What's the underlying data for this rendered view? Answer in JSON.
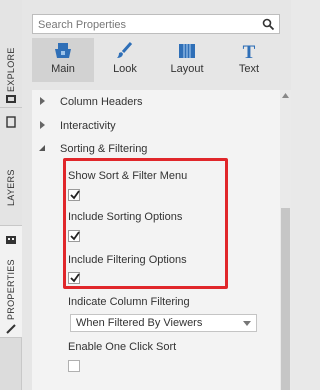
{
  "rail": {
    "tabs": [
      {
        "label": "EXPLORE",
        "icon": "explore-icon"
      },
      {
        "label": "LAYERS",
        "icon": "layers-icon"
      },
      {
        "label": "PROPERTIES",
        "icon": "properties-icon"
      }
    ]
  },
  "search": {
    "placeholder": "Search Properties",
    "icon": "search-icon"
  },
  "toptabs": [
    {
      "label": "Main",
      "icon": "main-icon"
    },
    {
      "label": "Look",
      "icon": "brush-icon"
    },
    {
      "label": "Layout",
      "icon": "layout-icon"
    },
    {
      "label": "Text",
      "icon": "text-icon"
    }
  ],
  "sections": [
    {
      "label": "Column Headers",
      "expanded": false
    },
    {
      "label": "Interactivity",
      "expanded": false
    },
    {
      "label": "Sorting & Filtering",
      "expanded": true
    }
  ],
  "properties": {
    "show_menu": {
      "label": "Show Sort & Filter Menu",
      "checked": true
    },
    "sorting": {
      "label": "Include Sorting Options",
      "checked": true
    },
    "filtering": {
      "label": "Include Filtering Options",
      "checked": true
    },
    "indicate": {
      "label": "Indicate Column Filtering",
      "value": "When Filtered By Viewers"
    },
    "one_click": {
      "label": "Enable One Click Sort",
      "checked": false
    }
  },
  "colors": {
    "highlight": "#e0262a",
    "active_tab": "#d2d2d2",
    "icon_blue": "#2f6fb7"
  }
}
